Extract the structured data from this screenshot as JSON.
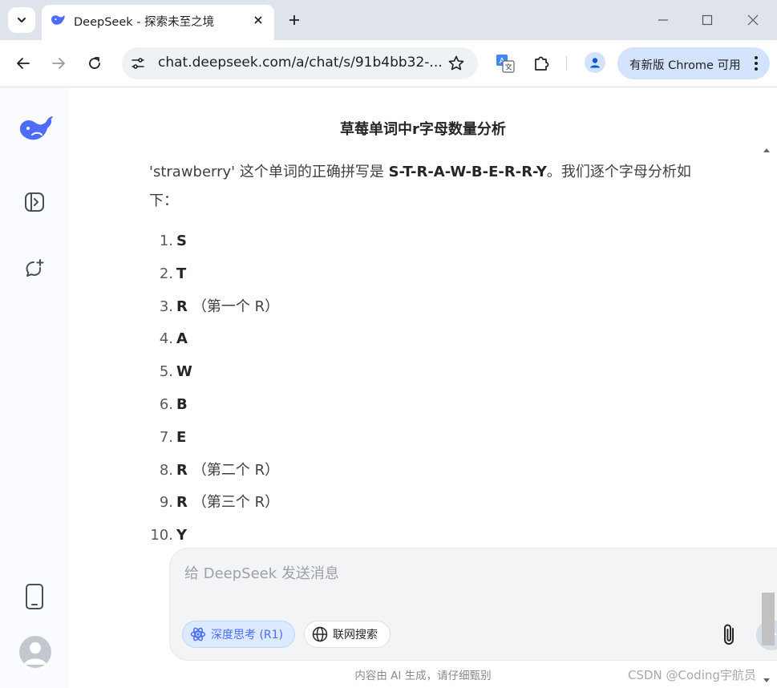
{
  "browser": {
    "tab": {
      "title": "DeepSeek - 探索未至之境",
      "favicon": "deepseek-whale-icon"
    },
    "address_bar": {
      "url": "chat.deepseek.com/a/chat/s/91b4bb32-..."
    },
    "update_button": {
      "label": "有新版 Chrome 可用"
    },
    "icons": [
      "tab-search-icon",
      "close-icon",
      "plus-icon",
      "minimize-icon",
      "maximize-icon",
      "back-arrow-icon",
      "forward-arrow-icon",
      "reload-icon",
      "site-settings-icon",
      "star-icon",
      "translate-icon",
      "extensions-puzzle-icon",
      "profile-icon",
      "kebab-menu-icon"
    ]
  },
  "sidebar": {
    "icons": [
      "deepseek-logo-icon",
      "toggle-sidebar-icon",
      "new-chat-icon",
      "mobile-app-icon",
      "user-avatar-icon"
    ]
  },
  "chat": {
    "title": "草莓单词中r字母数量分析",
    "intro": {
      "text_before": "'strawberry' 这个单词的正确拼写是 ",
      "bold": "S-T-R-A-W-B-E-R-R-Y",
      "text_after": "。我们逐个字母分析如下："
    },
    "letters": [
      {
        "num": "1.",
        "letter": "S",
        "note": ""
      },
      {
        "num": "2.",
        "letter": "T",
        "note": ""
      },
      {
        "num": "3.",
        "letter": "R",
        "note": "（第一个 R）"
      },
      {
        "num": "4.",
        "letter": "A",
        "note": ""
      },
      {
        "num": "5.",
        "letter": "W",
        "note": ""
      },
      {
        "num": "6.",
        "letter": "B",
        "note": ""
      },
      {
        "num": "7.",
        "letter": "E",
        "note": ""
      },
      {
        "num": "8.",
        "letter": "R",
        "note": "（第二个 R）"
      },
      {
        "num": "9.",
        "letter": "R",
        "note": "（第三个 R）"
      },
      {
        "num": "10.",
        "letter": "Y",
        "note": ""
      }
    ]
  },
  "composer": {
    "placeholder": "给 DeepSeek 发送消息",
    "deep_think_label": "深度思考 (R1)",
    "web_search_label": "联网搜索",
    "icons": [
      "atom-icon",
      "globe-icon",
      "paperclip-icon",
      "send-arrow-icon"
    ]
  },
  "footer_note": "内容由 AI 生成，请仔细甄别",
  "watermark": "CSDN @Coding宇航员",
  "colors": {
    "accent": "#4d6bfe",
    "tab_strip": "#dfe3eb",
    "update_pill": "#d3e3fd",
    "sidebar_bg": "#f9fbff"
  }
}
